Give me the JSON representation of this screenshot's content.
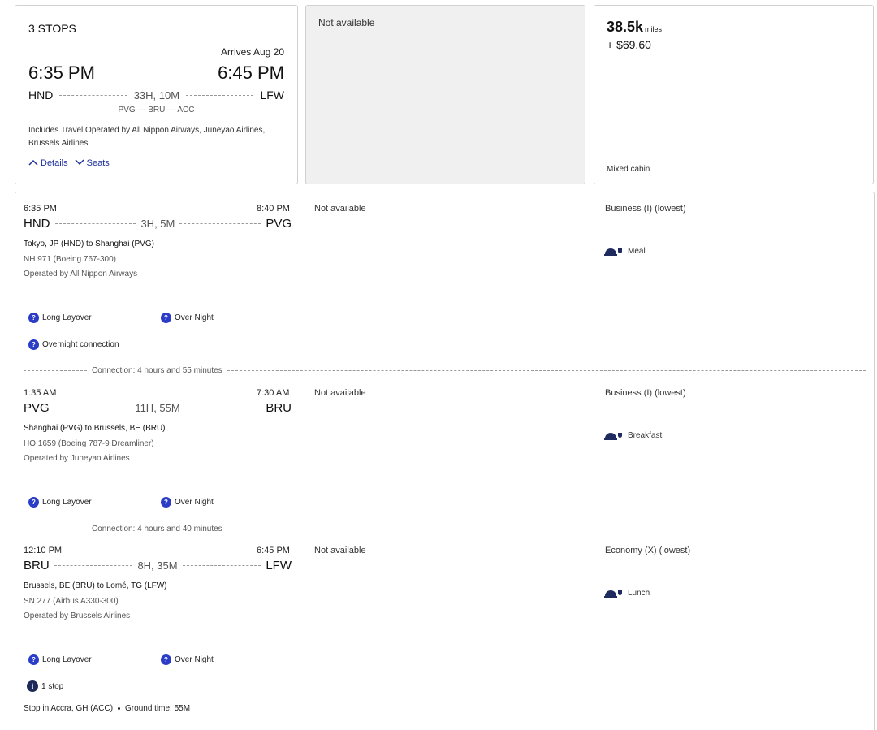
{
  "summary": {
    "stops": "3 STOPS",
    "arrives": "Arrives Aug 20",
    "dep_time": "6:35 PM",
    "arr_time": "6:45 PM",
    "origin": "HND",
    "destination": "LFW",
    "duration": "33H, 10M",
    "via": "PVG — BRU — ACC",
    "includes": "Includes Travel Operated by All Nippon Airways, Juneyao Airlines, Brussels Airlines",
    "details_label": "Details",
    "seats_label": "Seats"
  },
  "na_card": {
    "text": "Not available"
  },
  "miles_card": {
    "miles": "38.5k",
    "miles_unit": "miles",
    "plus": "+ $69.60",
    "cabin": "Mixed cabin"
  },
  "segments": [
    {
      "dep": "6:35 PM",
      "arr": "8:40 PM",
      "from": "HND",
      "to": "PVG",
      "duration": "3H, 5M",
      "title": "Tokyo, JP (HND) to Shanghai (PVG)",
      "flight": "NH 971 (Boeing 767-300)",
      "operated": "Operated by All Nippon Airways",
      "na": "Not available",
      "cabin": "Business (I) (lowest)",
      "meal": "Meal",
      "badge1": "Long Layover",
      "badge2": "Over Night",
      "badge3": "Overnight connection"
    },
    {
      "dep": "1:35 AM",
      "arr": "7:30 AM",
      "from": "PVG",
      "to": "BRU",
      "duration": "11H, 55M",
      "title": "Shanghai (PVG) to Brussels, BE (BRU)",
      "flight": "HO 1659 (Boeing 787-9 Dreamliner)",
      "operated": "Operated by Juneyao Airlines",
      "na": "Not available",
      "cabin": "Business (I) (lowest)",
      "meal": "Breakfast",
      "badge1": "Long Layover",
      "badge2": "Over Night"
    },
    {
      "dep": "12:10 PM",
      "arr": "6:45 PM",
      "from": "BRU",
      "to": "LFW",
      "duration": "8H, 35M",
      "title": "Brussels, BE (BRU) to Lomé, TG (LFW)",
      "flight": "SN 277 (Airbus A330-300)",
      "operated": "Operated by Brussels Airlines",
      "na": "Not available",
      "cabin": "Economy (X) (lowest)",
      "meal": "Lunch",
      "badge1": "Long Layover",
      "badge2": "Over Night",
      "stops": "1 stop",
      "stop_in": "Stop in Accra, GH (ACC)",
      "ground_time": "Ground time: 55M"
    }
  ],
  "connections": [
    "Connection: 4 hours and 55 minutes",
    "Connection: 4 hours and 40 minutes"
  ],
  "icons": {
    "question": "?",
    "info": "i"
  },
  "colors": {
    "link": "#1c2f9e",
    "badge": "#2b3cc7",
    "info": "#1b2a58",
    "na_bg": "#f0f0f0"
  }
}
